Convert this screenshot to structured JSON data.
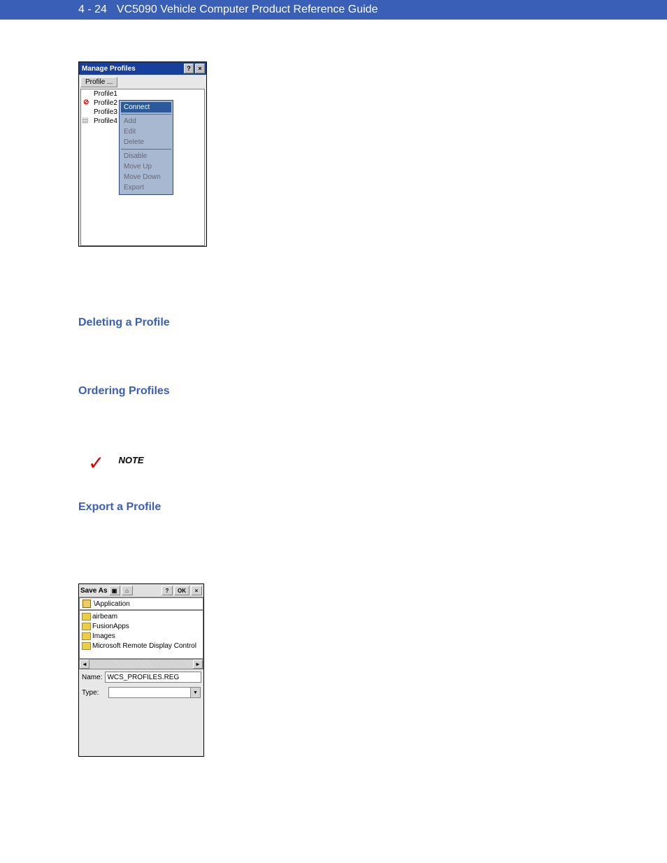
{
  "header": {
    "page_number": "4 - 24",
    "doc_title": "VC5090 Vehicle Computer Product Reference Guide"
  },
  "sections": {
    "deleting": "Deleting a Profile",
    "ordering": "Ordering Profiles",
    "export": "Export a Profile"
  },
  "note": {
    "label": "NOTE"
  },
  "manage_profiles": {
    "title": "Manage Profiles",
    "menu_tab": "Profile ...",
    "profiles": [
      "Profile1",
      "Profile2",
      "Profile3",
      "Profile4"
    ],
    "context": {
      "connect": "Connect",
      "add": "Add",
      "edit": "Edit",
      "delete": "Delete",
      "disable": "Disable",
      "move_up": "Move Up",
      "move_down": "Move Down",
      "export": "Export"
    }
  },
  "save_as": {
    "title": "Save As",
    "ok": "OK",
    "path": "\\Application",
    "folders": [
      "airbeam",
      "FusionApps",
      "Images",
      "Microsoft Remote Display Control"
    ],
    "name_label": "Name:",
    "name_value": "WCS_PROFILES.REG",
    "type_label": "Type:",
    "type_value": ""
  },
  "chart_data": null
}
